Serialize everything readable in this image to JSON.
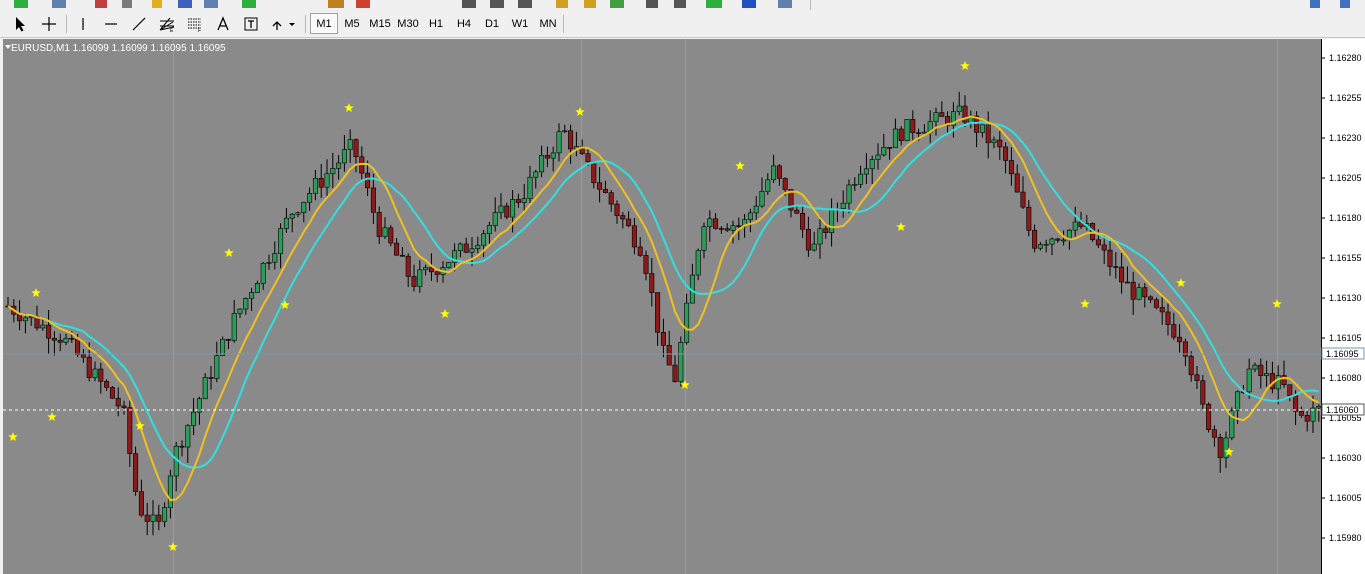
{
  "toolbar": {
    "timeframes": [
      "M1",
      "M5",
      "M15",
      "M30",
      "H1",
      "H4",
      "D1",
      "W1",
      "MN"
    ],
    "active_timeframe": "M1",
    "tools": [
      "cursor-icon",
      "crosshair-icon",
      "vertical-line-icon",
      "horizontal-line-icon",
      "trendline-icon",
      "fibonacci-fan-icon",
      "fibonacci-icon",
      "text-icon",
      "text-label-icon",
      "arrows-icon"
    ]
  },
  "chart": {
    "symbol_label": "EURUSD,M1  1.16099 1.16099 1.16095 1.16095",
    "price_labels": [
      "1.16280",
      "1.16255",
      "1.16230",
      "1.16205",
      "1.16180",
      "1.16155",
      "1.16130",
      "1.16105",
      "1.16080",
      "1.16055",
      "1.16030",
      "1.16005",
      "1.15980"
    ],
    "bid_label": "1.16095",
    "ask_label": "1.16060",
    "colors": {
      "background": "#8a8a8a",
      "bull": "#2d9c5a",
      "bear": "#8b1a1a",
      "ma_fast": "#f0c020",
      "ma_slow": "#30e0e0",
      "vline": "#20e070",
      "star": "#ffff00"
    }
  }
}
